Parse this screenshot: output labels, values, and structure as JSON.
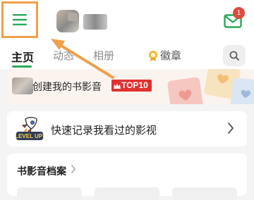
{
  "header": {
    "menu_icon": "hamburger-menu-icon",
    "avatar_icon": "avatar-blurred",
    "message_icon": "envelope-icon",
    "message_count": "1"
  },
  "tabs": [
    {
      "label": "主页",
      "active": true
    },
    {
      "label": "动态",
      "active": false
    },
    {
      "label": "相册",
      "active": false
    },
    {
      "label": "徽章",
      "active": false,
      "icon": "medal-icon"
    }
  ],
  "search_icon": "search-icon",
  "banner": {
    "text": "创建我的书影音",
    "tag": "TOP10"
  },
  "quick_record": {
    "text": "快速记录我看过的影视",
    "icon_text": "LEVEL UP!"
  },
  "archive": {
    "title": "书影音档案"
  },
  "colors": {
    "accent_green": "#2aa85a",
    "highlight_orange": "#f0a04b",
    "badge_red": "#e0483e",
    "top10_red": "#e03131"
  }
}
